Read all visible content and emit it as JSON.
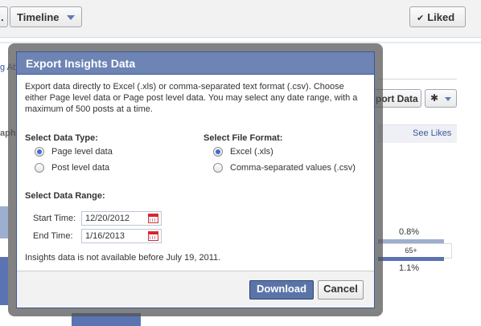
{
  "background": {
    "timeline_label": "Timeline",
    "liked_label": "Liked",
    "export_btn_partial": "port Data",
    "see_likes": "See Likes",
    "left_link_partial": "g Ab",
    "left_graph_partial": "aph",
    "age_label": "65+",
    "pct_top": "0.8%",
    "pct_bottom": "1.1%"
  },
  "dialog": {
    "title": "Export Insights Data",
    "description": "Export data directly to Excel (.xls) or comma-separated text format (.csv). Choose either Page level data or Page post level data. You may select any date range, with a maximum of 500 posts at a time.",
    "data_type": {
      "heading": "Select Data Type:",
      "options": [
        {
          "label": "Page level data",
          "selected": true
        },
        {
          "label": "Post level data",
          "selected": false
        }
      ]
    },
    "file_format": {
      "heading": "Select File Format:",
      "options": [
        {
          "label": "Excel (.xls)",
          "selected": true
        },
        {
          "label": "Comma-separated values (.csv)",
          "selected": false
        }
      ]
    },
    "date_range": {
      "heading": "Select Data Range:",
      "start_label": "Start Time:",
      "start_value": "12/20/2012",
      "end_label": "End Time:",
      "end_value": "1/16/2013"
    },
    "note": "Insights data is not available before July 19, 2011.",
    "download_label": "Download",
    "cancel_label": "Cancel"
  },
  "colors": {
    "title_bar": "#6d84b4",
    "primary_button": "#5b74a8",
    "link": "#3b5998",
    "radio_selected": "#3d6fd1"
  }
}
